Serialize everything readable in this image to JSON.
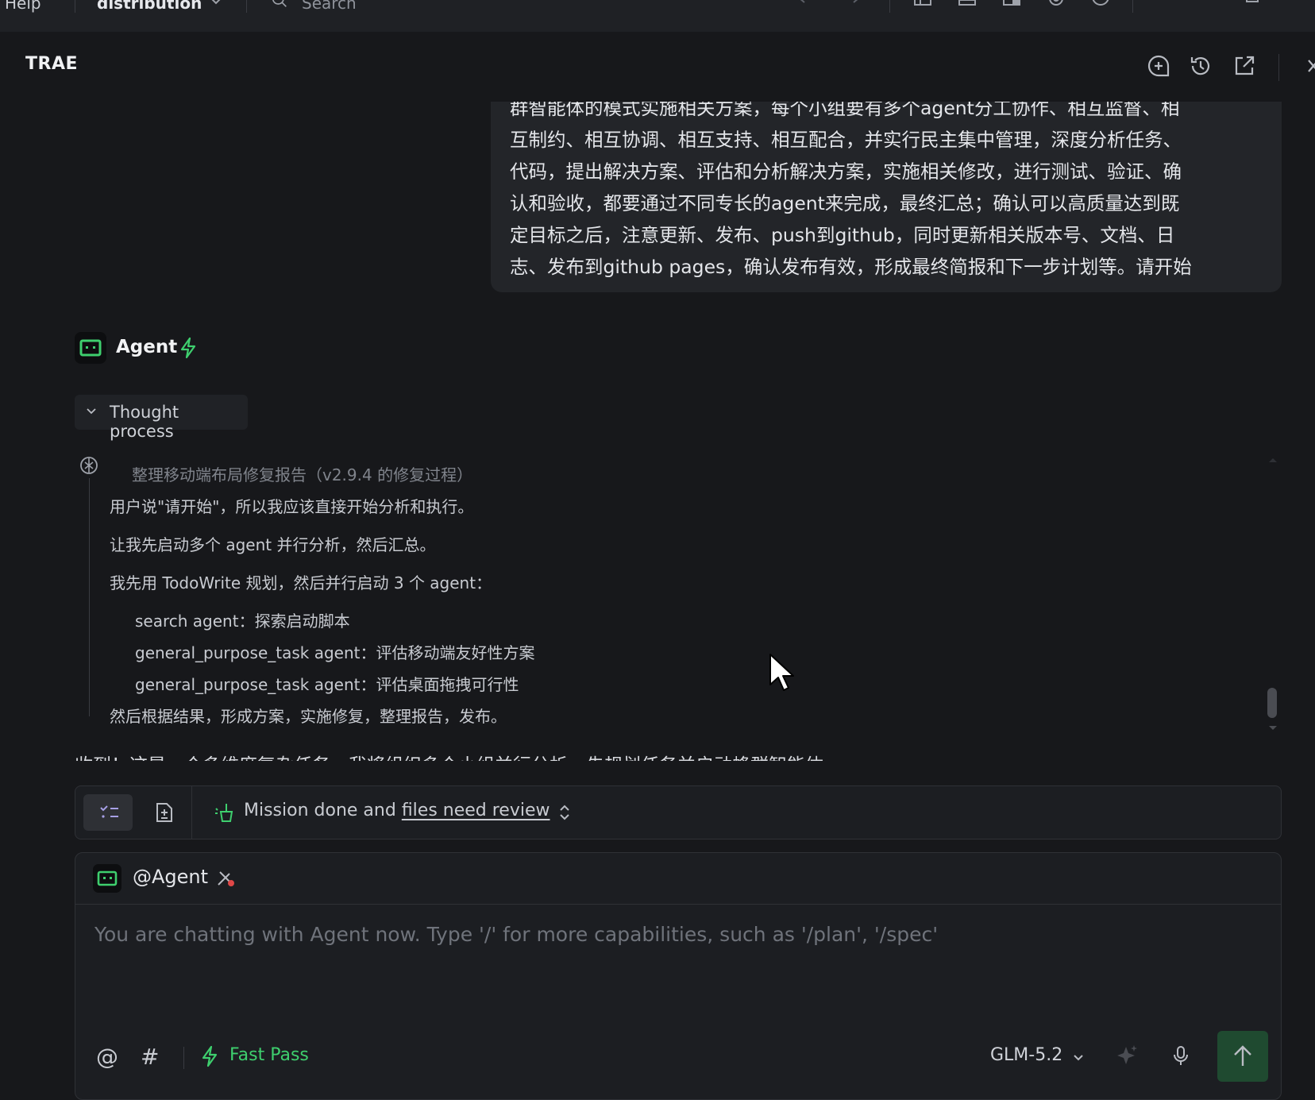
{
  "menubar": {
    "help": "Help",
    "project": "distribution",
    "search": "Search"
  },
  "header": {
    "brand": "TRAE",
    "icons": [
      "new-chat-icon",
      "history-icon",
      "open-external-icon",
      "close-icon"
    ]
  },
  "user_message": {
    "text": "群智能体的模式实施相关方案，每个小组要有多个agent分工协作、相互监督、相\n互制约、相互协调、相互支持、相互配合，并实行民主集中管理，深度分析任务、\n代码，提出解决方案、评估和分析解决方案，实施相关修改，进行测试、验证、确\n认和验收，都要通过不同专长的agent来完成，最终汇总；确认可以高质量达到既\n定目标之后，注意更新、发布、push到github，同时更新相关版本号、文档、日\n志、发布到github pages，确认发布有效，形成最终简报和下一步计划等。请开始"
  },
  "agent": {
    "name": "Agent",
    "thought_label": "Thought process",
    "thought": {
      "title": "整理移动端布局修复报告（v2.9.4 的修复过程）",
      "line1": "用户说\"请开始\"，所以我应该直接开始分析和执行。",
      "line2": "让我先启动多个 agent 并行分析，然后汇总。",
      "line3": "我先用 TodoWrite 规划，然后并行启动 3 个 agent：",
      "item1": "search agent：探索启动脚本",
      "item2": "general_purpose_task agent：评估移动端友好性方案",
      "item3": "general_purpose_task agent：评估桌面拖拽可行性",
      "line4": "然后根据结果，形成方案，实施修复，整理报告，发布。"
    },
    "reply_partial": "收到！这是一个多维度复杂任务，我将组织多个小组并行分析，先规划任务并启动蜂群智能体"
  },
  "mission": {
    "prefix": "Mission done and ",
    "link": "files need review"
  },
  "input": {
    "mention": "@Agent",
    "placeholder": "You are chatting with Agent now. Type '/' for more capabilities, such as '/plan', '/spec'",
    "at_symbol": "@",
    "hash_symbol": "#",
    "fast_pass": "Fast Pass",
    "model": "GLM-5.2"
  },
  "colors": {
    "accent_green": "#3ecf6e",
    "send_bg": "#1f4a30",
    "background": "#17181b"
  }
}
